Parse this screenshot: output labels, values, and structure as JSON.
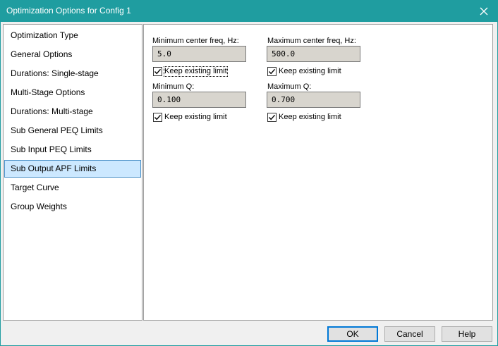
{
  "window": {
    "title": "Optimization Options for Config 1"
  },
  "sidebar": {
    "items": [
      {
        "label": "Optimization Type"
      },
      {
        "label": "General Options"
      },
      {
        "label": "Durations: Single-stage"
      },
      {
        "label": "Multi-Stage Options"
      },
      {
        "label": "Durations: Multi-stage"
      },
      {
        "label": "Sub General PEQ Limits"
      },
      {
        "label": "Sub Input PEQ Limits"
      },
      {
        "label": "Sub Output APF Limits",
        "selected": true
      },
      {
        "label": "Target Curve"
      },
      {
        "label": "Group Weights"
      }
    ]
  },
  "panel": {
    "min_freq": {
      "label": "Minimum center freq, Hz:",
      "value": "5.0",
      "keep_label": "Keep existing limit",
      "keep_checked": true
    },
    "max_freq": {
      "label": "Maximum center freq, Hz:",
      "value": "500.0",
      "keep_label": "Keep existing limit",
      "keep_checked": true
    },
    "min_q": {
      "label": "Minimum Q:",
      "value": "0.100",
      "keep_label": "Keep existing limit",
      "keep_checked": true
    },
    "max_q": {
      "label": "Maximum Q:",
      "value": "0.700",
      "keep_label": "Keep existing limit",
      "keep_checked": true
    }
  },
  "buttons": {
    "ok": "OK",
    "cancel": "Cancel",
    "help": "Help"
  }
}
